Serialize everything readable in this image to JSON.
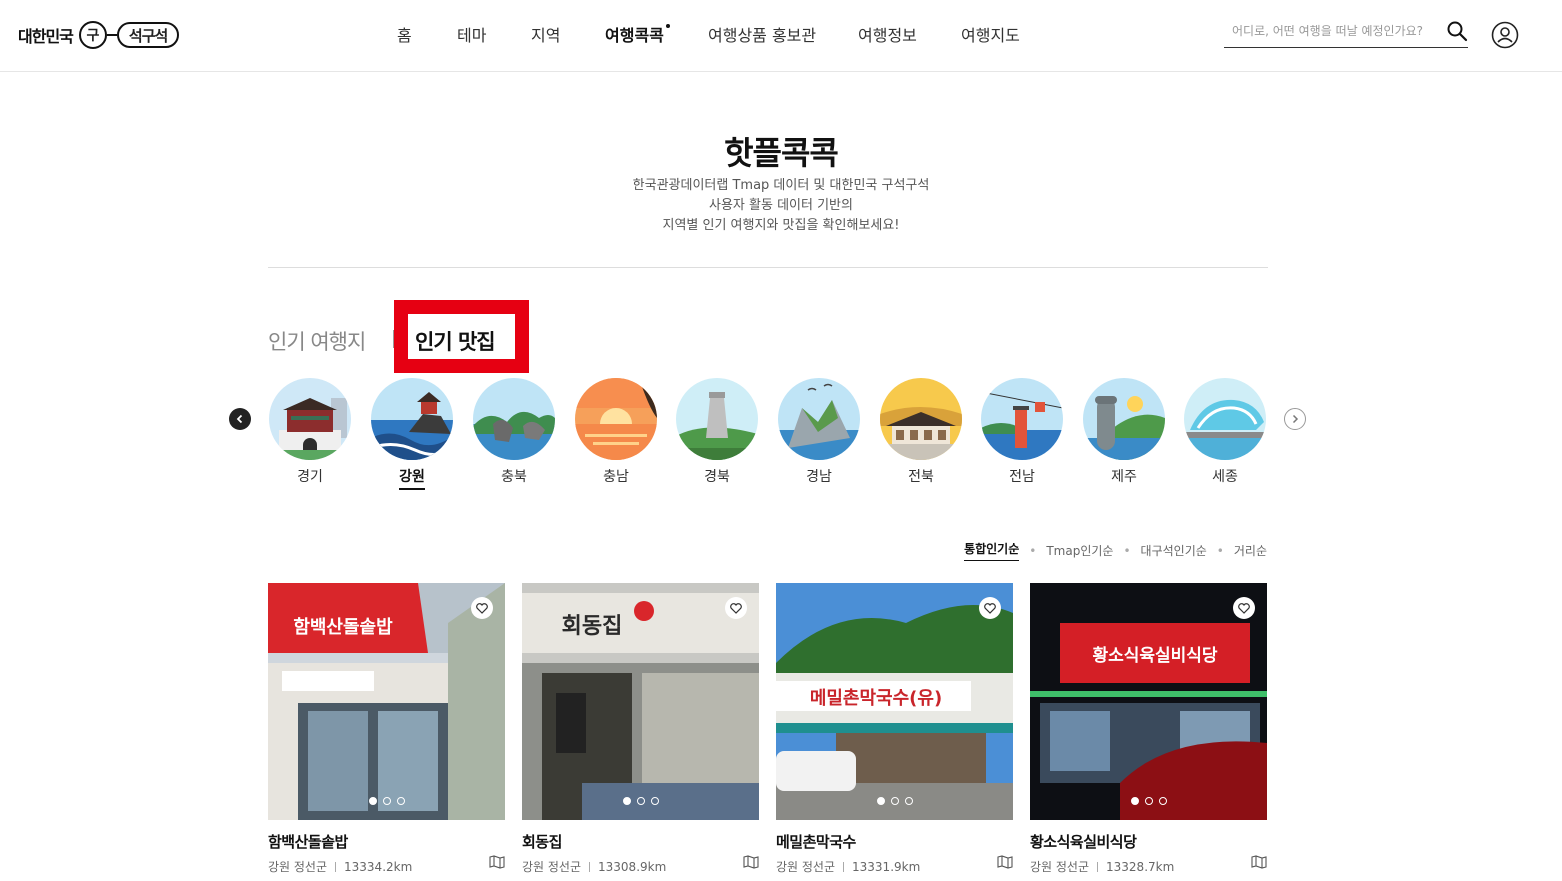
{
  "header": {
    "logo_text": "대한민국",
    "logo_circle": "구",
    "logo_pill": "석구석",
    "nav": [
      {
        "label": "홈"
      },
      {
        "label": "테마"
      },
      {
        "label": "지역"
      },
      {
        "label": "여행콕콕",
        "active": true
      },
      {
        "label": "여행상품 홍보관"
      },
      {
        "label": "여행정보"
      },
      {
        "label": "여행지도"
      }
    ],
    "search_placeholder": "어디로, 어떤 여행을 떠날 예정인가요?"
  },
  "page": {
    "title": "핫플콕콕",
    "desc_lines": [
      "한국관광데이터랩 Tmap 데이터 및 대한민국 구석구석",
      "사용자 활동 데이터 기반의",
      "지역별 인기 여행지와 맛집을 확인해보세요!"
    ]
  },
  "tabs": {
    "popular_places": "인기 여행지",
    "popular_food": "인기 맛집",
    "active": "popular_food"
  },
  "regions": [
    {
      "label": "경기"
    },
    {
      "label": "강원",
      "active": true
    },
    {
      "label": "충북"
    },
    {
      "label": "충남"
    },
    {
      "label": "경북"
    },
    {
      "label": "경남"
    },
    {
      "label": "전북"
    },
    {
      "label": "전남"
    },
    {
      "label": "제주"
    },
    {
      "label": "세종"
    }
  ],
  "sort": {
    "options": [
      "통합인기순",
      "Tmap인기순",
      "대구석인기순",
      "거리순"
    ],
    "active": "통합인기순"
  },
  "cards": [
    {
      "name": "함백산돌솥밥",
      "region": "강원 정선군",
      "distance": "13334.2km",
      "sign": "함백산돌솥밥"
    },
    {
      "name": "회동집",
      "region": "강원 정선군",
      "distance": "13308.9km",
      "sign": "회동집"
    },
    {
      "name": "메밀촌막국수",
      "region": "강원 정선군",
      "distance": "13331.9km",
      "sign": "메밀촌막국수(유)"
    },
    {
      "name": "황소식육실비식당",
      "region": "강원 정선군",
      "distance": "13328.7km",
      "sign": "황소식육실비식당"
    }
  ],
  "colors": {
    "highlight": "#e60012",
    "text_dark": "#111111",
    "text_muted": "#666666"
  }
}
